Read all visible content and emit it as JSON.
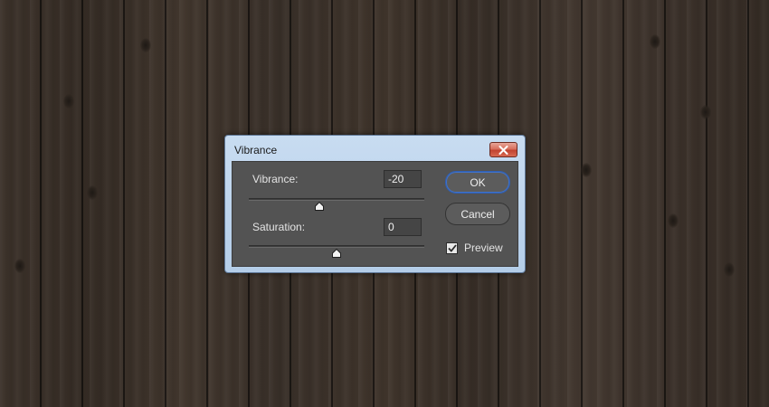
{
  "dialog": {
    "title": "Vibrance",
    "close_icon": "close-icon",
    "vibrance": {
      "label": "Vibrance:",
      "value": "-20",
      "slider_min": -100,
      "slider_max": 100,
      "slider_value": -20
    },
    "saturation": {
      "label": "Saturation:",
      "value": "0",
      "slider_min": -100,
      "slider_max": 100,
      "slider_value": 0
    },
    "ok_label": "OK",
    "cancel_label": "Cancel",
    "preview": {
      "label": "Preview",
      "checked": true
    }
  },
  "colors": {
    "panel": "#535353",
    "titlebar": "#c8dcf1",
    "close_button": "#c1422f",
    "default_button_border": "#2f5fb4"
  }
}
